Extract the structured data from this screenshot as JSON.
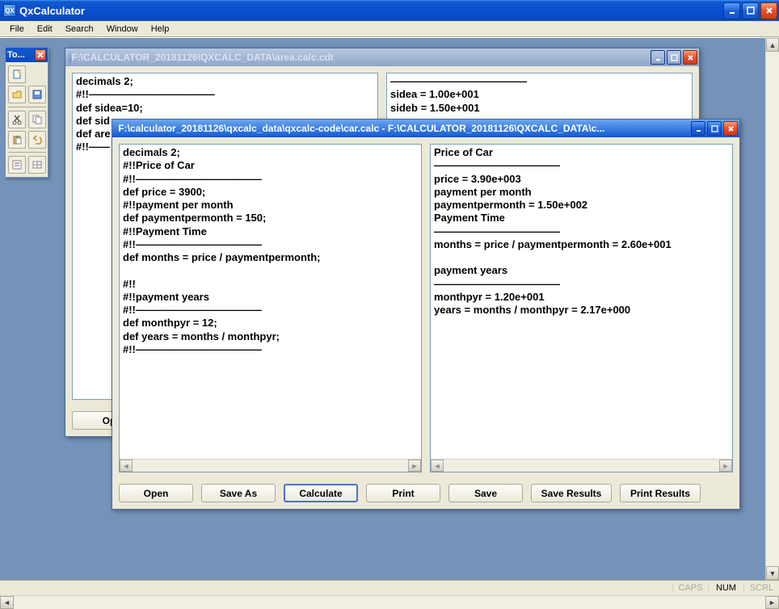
{
  "app": {
    "title": "QxCalculator",
    "icon_label": "QX"
  },
  "menubar": {
    "items": [
      {
        "label": "File"
      },
      {
        "label": "Edit"
      },
      {
        "label": "Search"
      },
      {
        "label": "Window"
      },
      {
        "label": "Help"
      }
    ]
  },
  "toolbox": {
    "title": "To..."
  },
  "statusbar": {
    "caps": "CAPS",
    "num": "NUM",
    "scrl": "SCRL"
  },
  "windows": {
    "bg": {
      "title": "F:\\CALCULATOR_20181126\\QXCALC_DATA\\area.calc.cdt",
      "left_code": "decimals 2;\n#!!————————————\ndef sidea=10;\ndef sid\ndef are\n#!!——",
      "right_code": "—————————————\nsidea = 1.00e+001\nsideb = 1.50e+001",
      "open_label": "Op"
    },
    "fg": {
      "title": "F:\\calculator_20181126\\qxcalc_data\\qxcalc-code\\car.calc - F:\\CALCULATOR_20181126\\QXCALC_DATA\\c...",
      "left_code": "decimals 2;\n#!!Price of Car\n#!!————————————\ndef price = 3900;\n#!!payment per month\ndef paymentpermonth = 150;\n#!!Payment Time\n#!!————————————\ndef months = price / paymentpermonth;\n\n#!!\n#!!payment years\n#!!————————————\ndef monthpyr = 12;\ndef years = months / monthpyr;\n#!!————————————",
      "right_code": "Price of Car\n————————————\nprice = 3.90e+003\npayment per month\npaymentpermonth = 1.50e+002\nPayment Time\n————————————\nmonths = price / paymentpermonth = 2.60e+001\n\npayment years\n————————————\nmonthpyr = 1.20e+001\nyears = months / monthpyr = 2.17e+000",
      "buttons": {
        "open": "Open",
        "save_as": "Save As",
        "calculate": "Calculate",
        "print": "Print",
        "save": "Save",
        "save_results": "Save Results",
        "print_results": "Print Results"
      }
    }
  }
}
